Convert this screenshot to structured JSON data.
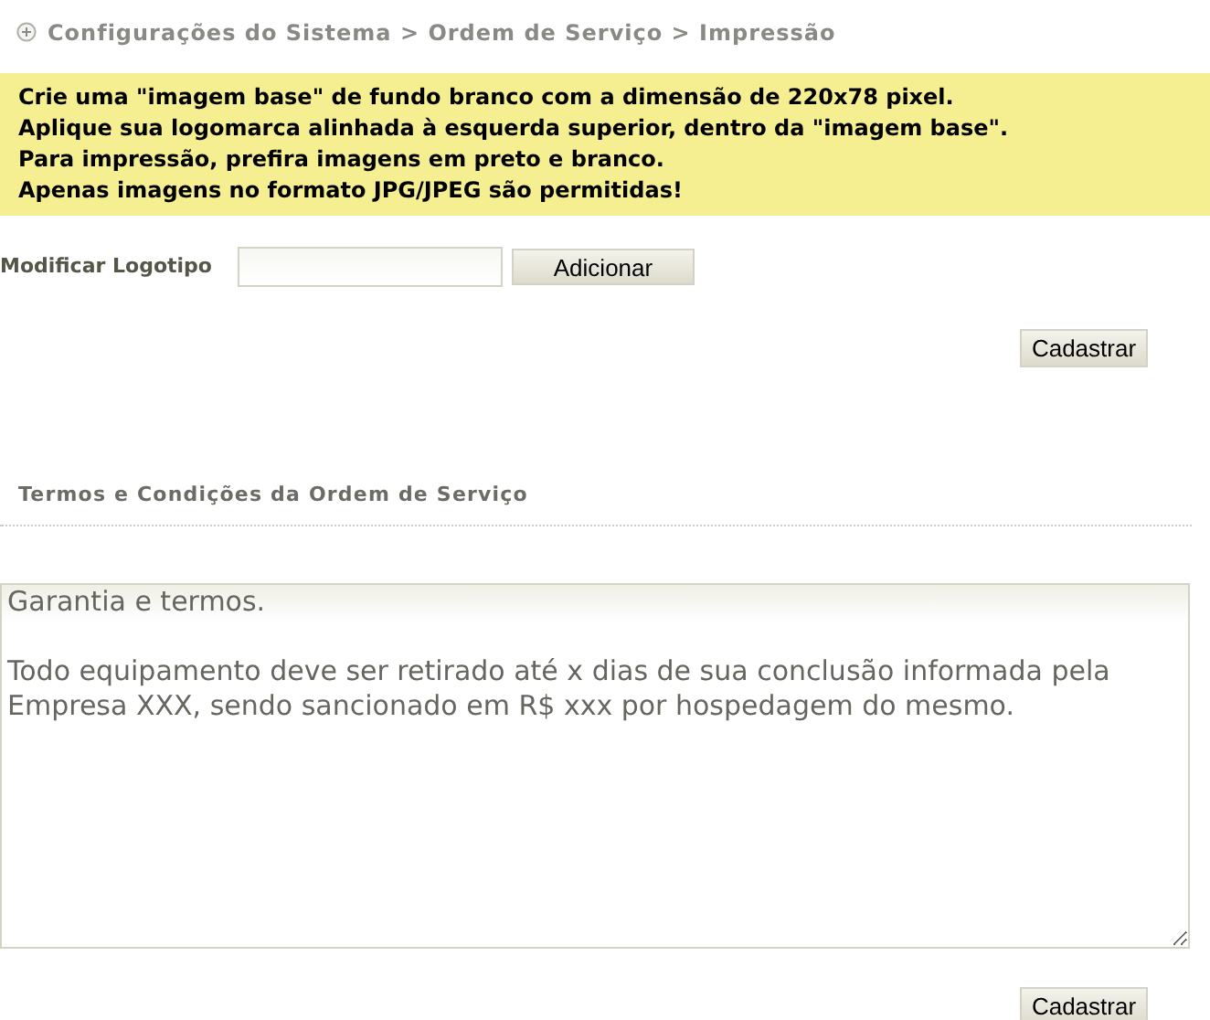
{
  "breadcrumb": {
    "text": "Configurações do Sistema > Ordem de Serviço > Impressão"
  },
  "notice": {
    "lines": [
      "Crie uma \"imagem base\" de fundo branco com a dimensão de 220x78 pixel.",
      "Aplique sua logomarca alinhada à esquerda superior, dentro da \"imagem base\".",
      "Para impressão, prefira imagens em preto e branco.",
      "Apenas imagens no formato JPG/JPEG são permitidas!"
    ]
  },
  "logo_form": {
    "label": "Modificar Logotipo",
    "add_button": "Adicionar",
    "submit_button": "Cadastrar"
  },
  "terms": {
    "title": "Termos e Condições da Ordem de Serviço",
    "value": "Garantia e termos.\n\nTodo equipamento deve ser retirado até x dias de sua conclusão informada pela Empresa XXX, sendo sancionado em R$ xxx por hospedagem do mesmo.",
    "submit_button": "Cadastrar"
  }
}
